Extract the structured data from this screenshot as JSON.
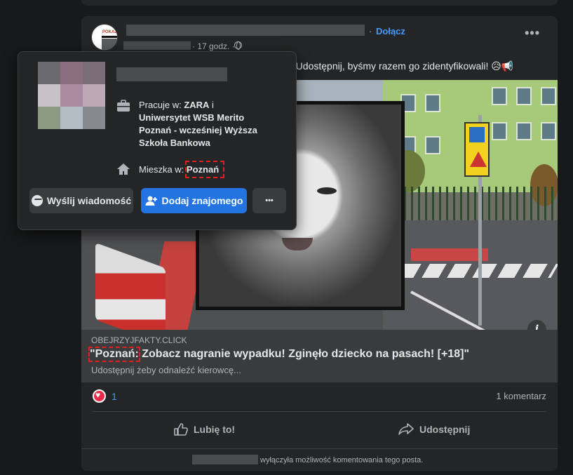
{
  "post": {
    "join_label": "Dołącz",
    "separator": "·",
    "time": "· 17 godz. ·",
    "text": "ekł! Udostępnij, byśmy razem go zidentyfikowali! 😥📢",
    "avatar_logo_text": "POKAŻ",
    "more_label": "•••"
  },
  "link": {
    "domain": "OBEJRZYJFAKTY.CLICK",
    "title_highlight": "\"Poznań:",
    "title_rest": " Zobacz nagranie wypadku! Zginęło dziecko na pasach! [+18]\"",
    "description": "Udostępnij żeby odnaleźć kierowcę..."
  },
  "reactions": {
    "count": "1",
    "comments": "1 komentarz"
  },
  "actions": {
    "like": "Lubię to!",
    "share": "Udostępnij"
  },
  "comment_notice": "wyłączyła możliwość komentowania tego posta.",
  "info_label": "i",
  "popover": {
    "work_prefix": "Pracuje w: ",
    "work_company": "ZARA",
    "work_and": " i",
    "work_line2": "Uniwersytet WSB Merito",
    "work_line3": "Poznań - wcześniej Wyższa",
    "work_line4": "Szkoła Bankowa",
    "lives_prefix": "Mieszka w: ",
    "lives_city": "Poznań",
    "message_button": "Wyślij wiadomość",
    "add_friend_button": "Dodaj znajomego",
    "more_button": "•••"
  },
  "colors": {
    "accent_blue": "#2374e1",
    "link_blue": "#4599ff",
    "highlight_red": "#e0201c",
    "surface": "#242526",
    "background": "#18191a"
  },
  "icons": [
    "globe-icon",
    "more-icon",
    "info-icon",
    "heart-icon",
    "like-icon",
    "share-icon",
    "briefcase-icon",
    "home-icon",
    "messenger-icon",
    "add-friend-icon"
  ]
}
